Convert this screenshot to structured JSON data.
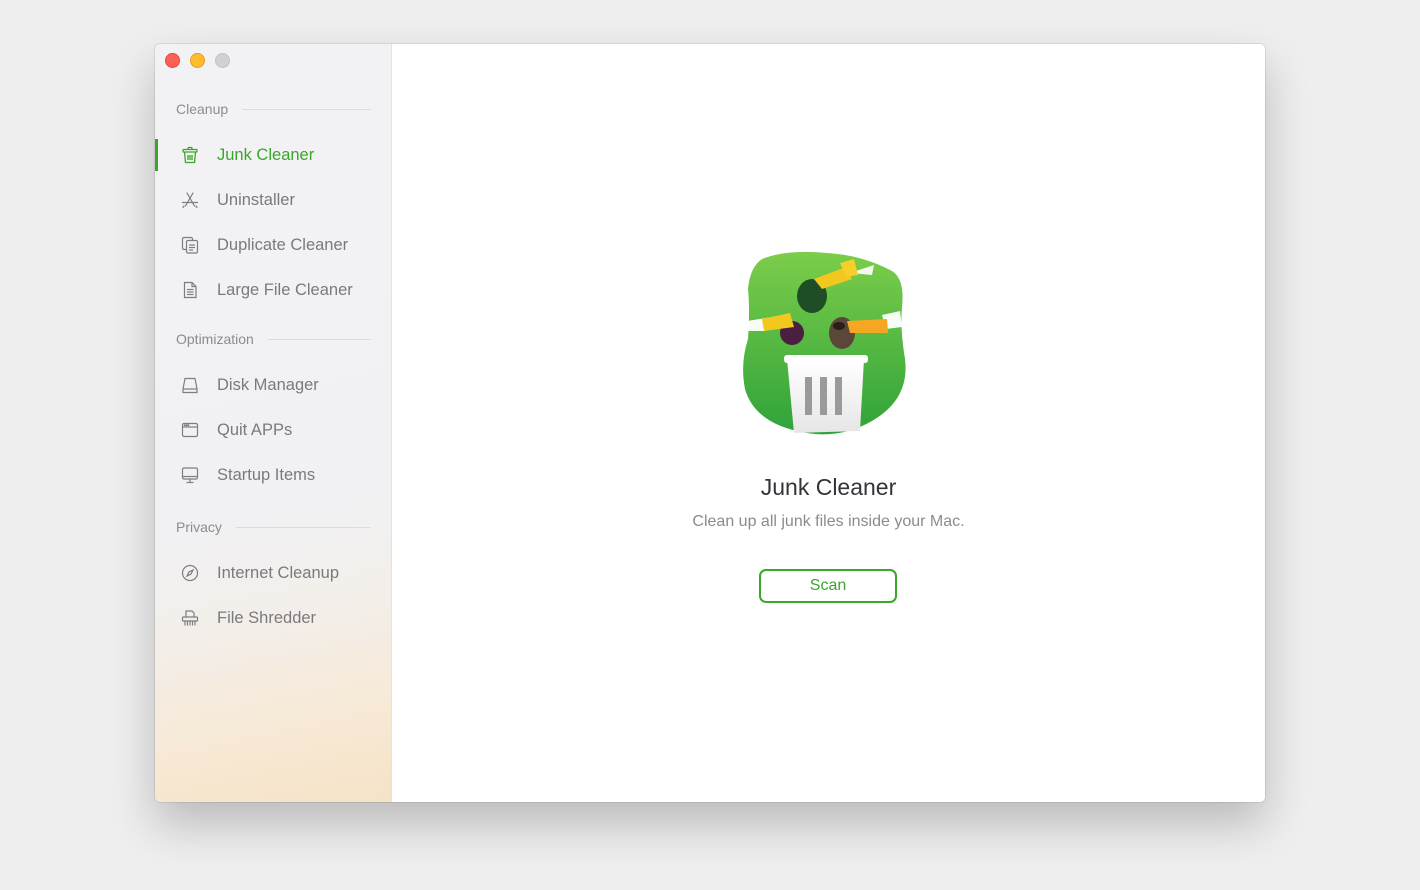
{
  "window": {
    "controls": [
      "close",
      "minimize",
      "zoom"
    ]
  },
  "sidebar": {
    "sections": [
      {
        "title": "Cleanup",
        "items": [
          {
            "label": "Junk Cleaner",
            "icon": "trash-icon",
            "active": true
          },
          {
            "label": "Uninstaller",
            "icon": "app-store-icon",
            "active": false
          },
          {
            "label": "Duplicate Cleaner",
            "icon": "duplicate-icon",
            "active": false
          },
          {
            "label": "Large File Cleaner",
            "icon": "document-icon",
            "active": false
          }
        ]
      },
      {
        "title": "Optimization",
        "items": [
          {
            "label": "Disk Manager",
            "icon": "disk-icon",
            "active": false
          },
          {
            "label": "Quit APPs",
            "icon": "window-icon",
            "active": false
          },
          {
            "label": "Startup Items",
            "icon": "monitor-icon",
            "active": false
          }
        ]
      },
      {
        "title": "Privacy",
        "items": [
          {
            "label": "Internet Cleanup",
            "icon": "compass-icon",
            "active": false
          },
          {
            "label": "File Shredder",
            "icon": "shredder-icon",
            "active": false
          }
        ]
      }
    ]
  },
  "main": {
    "title": "Junk Cleaner",
    "subtitle": "Clean up all junk files inside your Mac.",
    "scan_label": "Scan",
    "hero_icon": "junk-cleaner-illustration-icon"
  },
  "colors": {
    "accent": "#3aa62a",
    "sidebar_text": "#7a7a7e",
    "section_text": "#8c8c90"
  }
}
